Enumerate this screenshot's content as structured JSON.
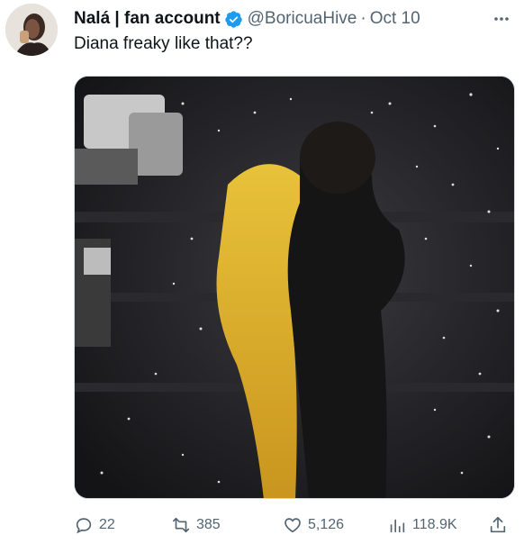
{
  "author": {
    "display_name": "Nalá | fan account",
    "handle": "@BoricuaHive",
    "separator": "·",
    "date": "Oct 10",
    "verified": true,
    "avatar_icon": "profile-photo"
  },
  "post": {
    "text": "Diana freaky like that??"
  },
  "media": {
    "kind": "photo",
    "icon": "concert-photo"
  },
  "actions": {
    "replies": "22",
    "retweets": "385",
    "likes": "5,126",
    "views": "118.9K"
  },
  "colors": {
    "verified_blue": "#1d9bf0",
    "secondary_text": "#536471",
    "primary_text": "#0f1419"
  }
}
